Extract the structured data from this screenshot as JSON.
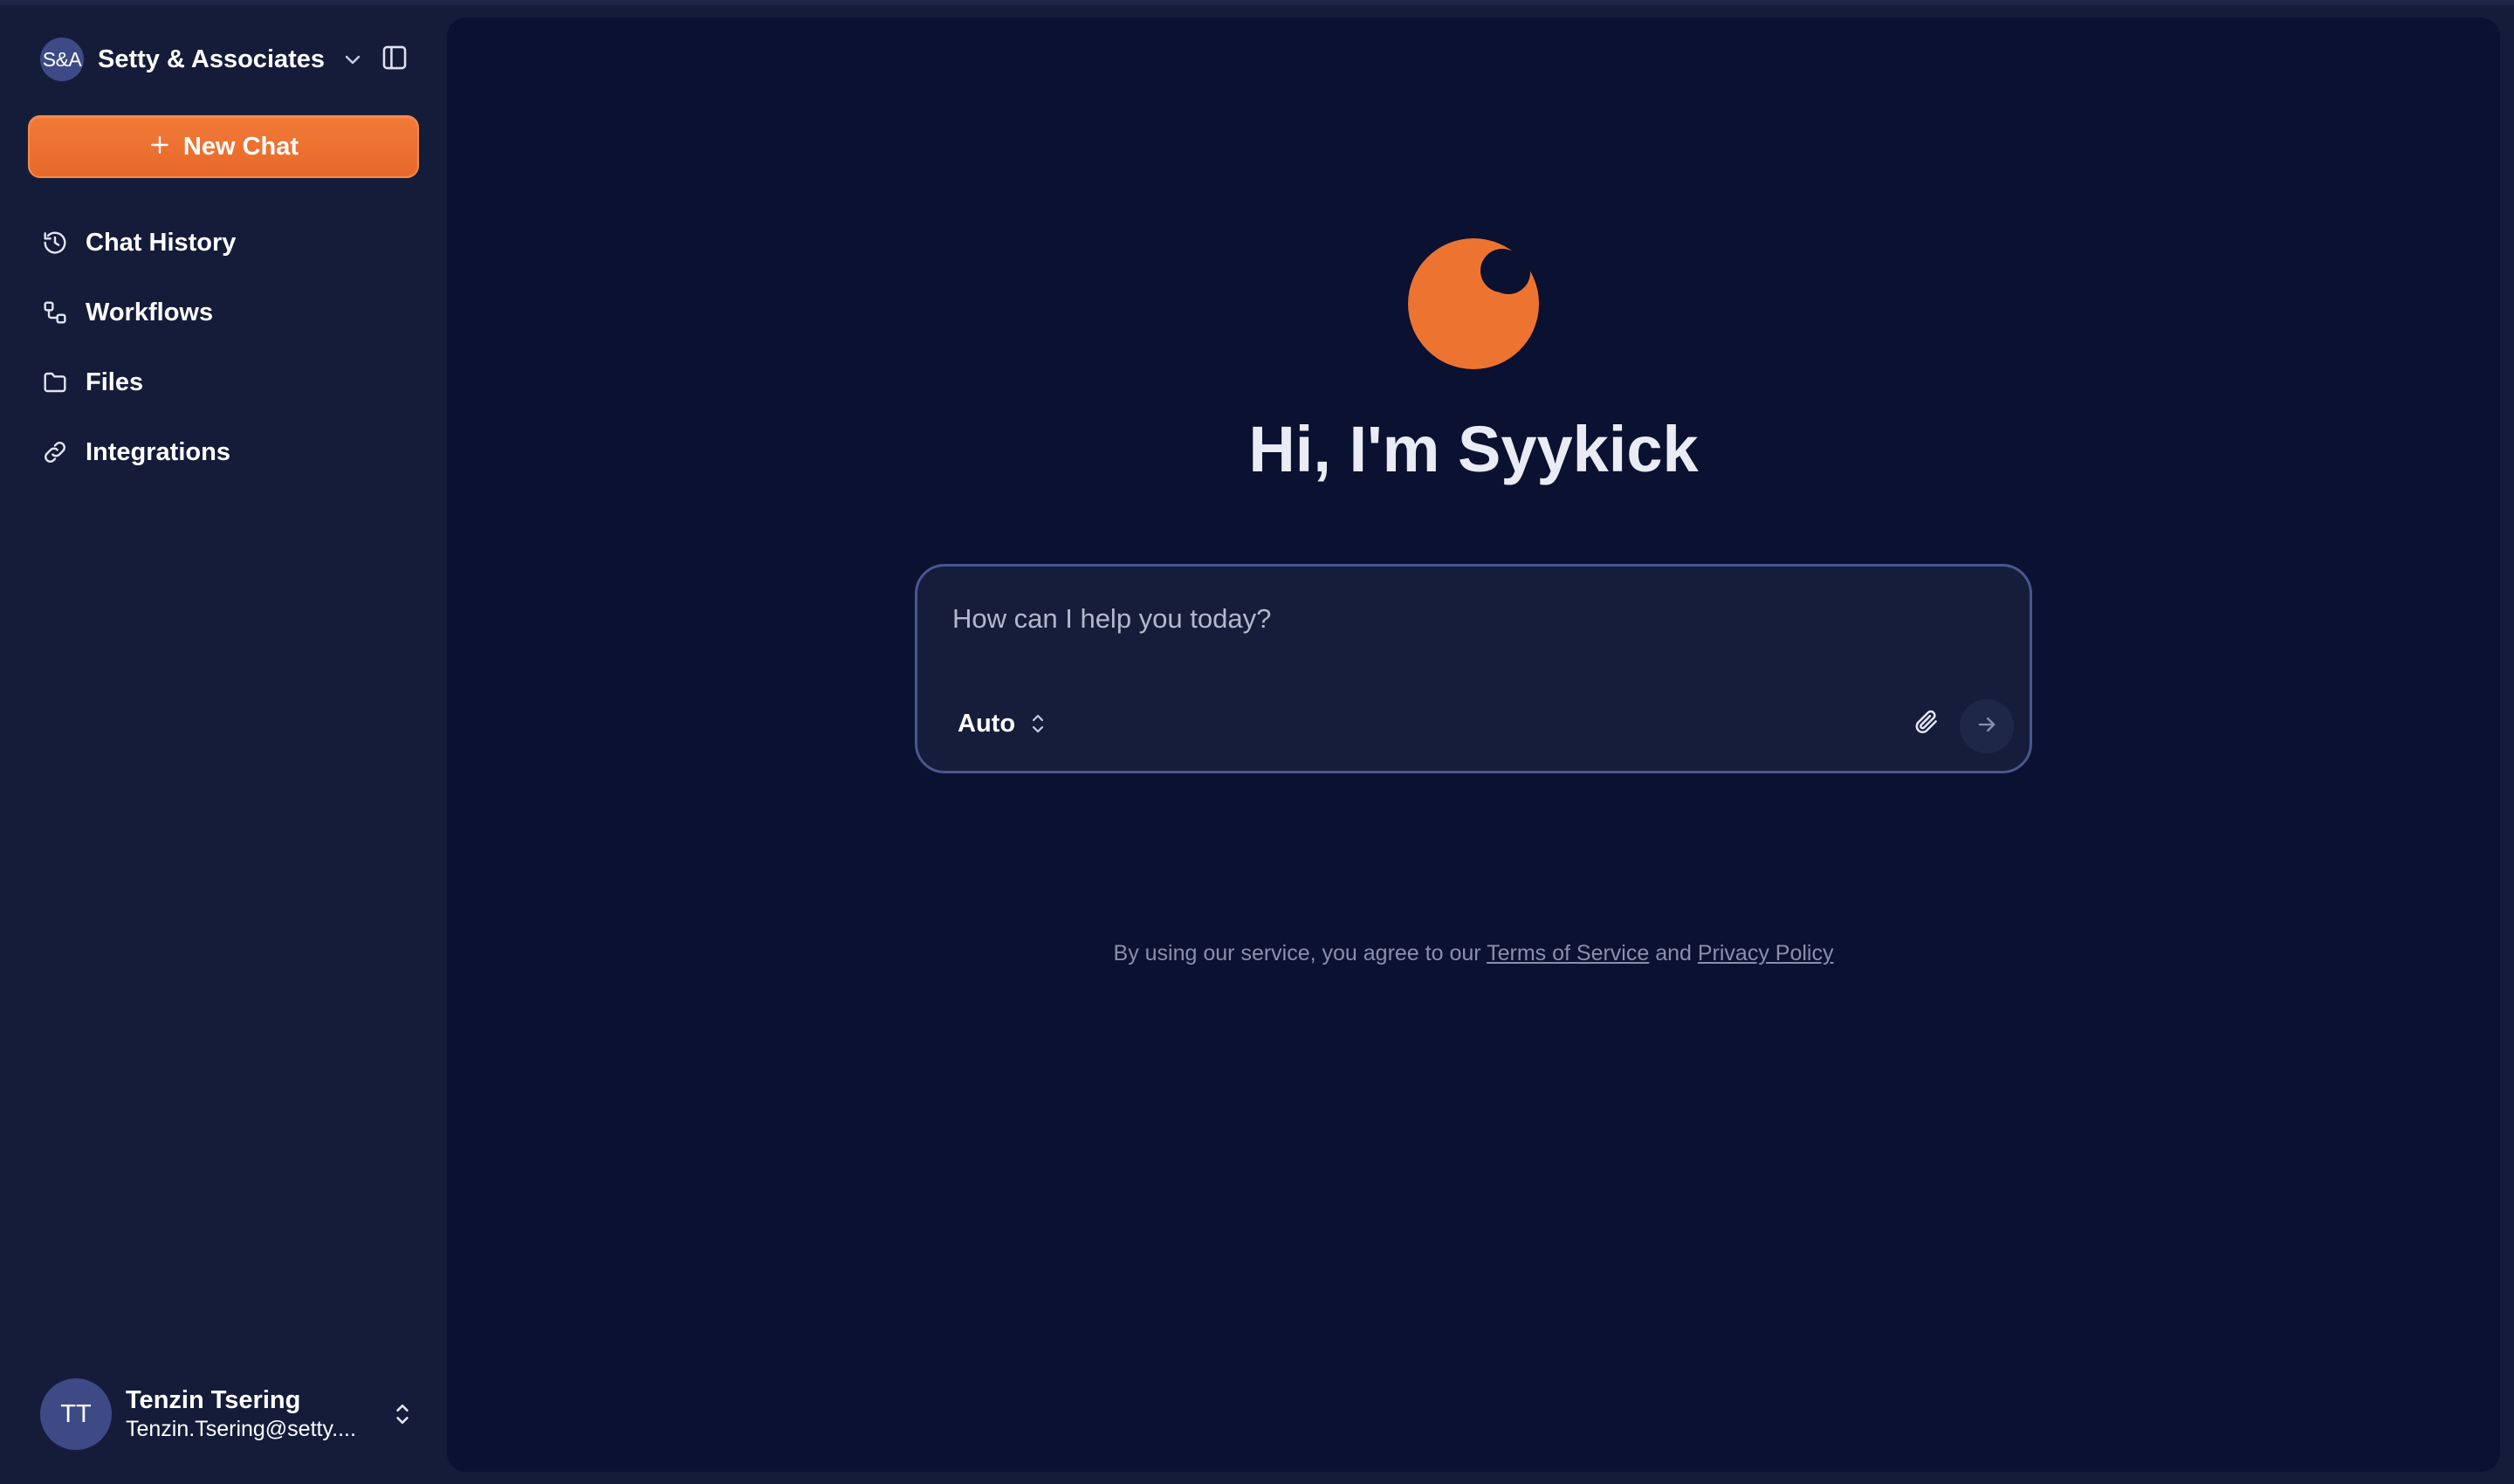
{
  "workspace": {
    "initials": "S&A",
    "name": "Setty & Associates"
  },
  "new_chat": {
    "label": "New Chat"
  },
  "nav": {
    "items": [
      {
        "label": "Chat History",
        "icon": "history-icon"
      },
      {
        "label": "Workflows",
        "icon": "workflow-icon"
      },
      {
        "label": "Files",
        "icon": "folder-icon"
      },
      {
        "label": "Integrations",
        "icon": "link-icon"
      }
    ]
  },
  "user": {
    "initials": "TT",
    "name": "Tenzin Tsering",
    "email": "Tenzin.Tsering@setty...."
  },
  "main": {
    "greeting": "Hi, I'm Syykick",
    "composer": {
      "placeholder": "How can I help you today?",
      "mode": "Auto"
    },
    "legal": {
      "prefix": "By using our service, you agree to our ",
      "terms": "Terms of Service",
      "middle": " and ",
      "privacy": "Privacy Policy"
    }
  },
  "colors": {
    "accent": "#ED7430",
    "sidebar_bg": "#151C3A",
    "main_bg": "#0B1130",
    "composer_border": "#4A5590"
  }
}
